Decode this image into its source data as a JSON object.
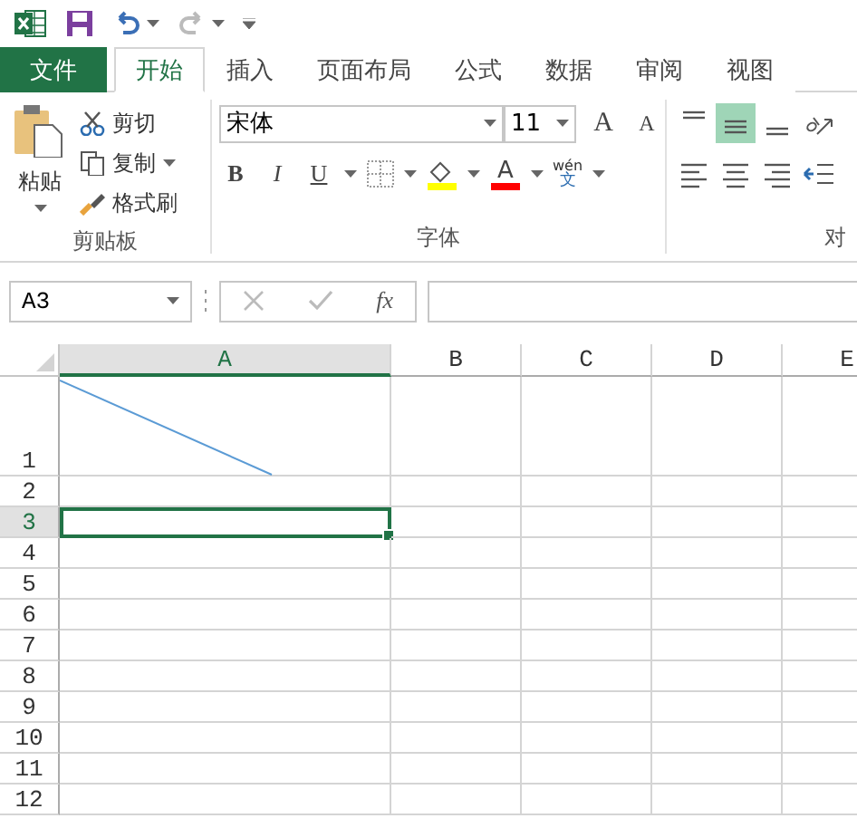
{
  "quick_access": [
    {
      "kind": "save",
      "disabled": false
    },
    {
      "kind": "undo",
      "disabled": false
    },
    {
      "kind": "redo",
      "disabled": true
    }
  ],
  "tabs": [
    {
      "label": "文件",
      "kind": "file",
      "selected": false
    },
    {
      "label": "开始",
      "kind": "tab",
      "selected": true
    },
    {
      "label": "插入",
      "kind": "tab",
      "selected": false
    },
    {
      "label": "页面布局",
      "kind": "tab",
      "selected": false
    },
    {
      "label": "公式",
      "kind": "tab",
      "selected": false
    },
    {
      "label": "数据",
      "kind": "tab",
      "selected": false
    },
    {
      "label": "审阅",
      "kind": "tab",
      "selected": false
    },
    {
      "label": "视图",
      "kind": "tab",
      "selected": false
    }
  ],
  "clipboard": {
    "paste": "粘贴",
    "cut": "剪切",
    "copy": "复制",
    "format_painter": "格式刷",
    "label": "剪贴板"
  },
  "font": {
    "name": "宋体",
    "size": "11",
    "grow": "A",
    "shrink": "A",
    "bold": "B",
    "italic": "I",
    "underline": "U",
    "font_color": "A",
    "phonetic_top": "wén",
    "phonetic_bottom": "文",
    "label": "字体"
  },
  "alignment": {
    "label": "对",
    "buttons": [
      {
        "kind": "top",
        "selected": false
      },
      {
        "kind": "middle",
        "selected": true
      },
      {
        "kind": "bottom",
        "selected": false
      },
      {
        "kind": "orient",
        "selected": false
      },
      {
        "kind": "left",
        "selected": false
      },
      {
        "kind": "center",
        "selected": false
      },
      {
        "kind": "right",
        "selected": false
      },
      {
        "kind": "outdent",
        "selected": false
      }
    ]
  },
  "formula_bar": {
    "name_box": "A3",
    "fx": "fx"
  },
  "sheet": {
    "columns": [
      {
        "label": "A",
        "selected": true
      },
      {
        "label": "B",
        "selected": false
      },
      {
        "label": "C",
        "selected": false
      },
      {
        "label": "D",
        "selected": false
      },
      {
        "label": "E",
        "selected": false
      }
    ],
    "rows": [
      {
        "label": "1",
        "selected": false
      },
      {
        "label": "2",
        "selected": false
      },
      {
        "label": "3",
        "selected": true
      },
      {
        "label": "4",
        "selected": false
      },
      {
        "label": "5",
        "selected": false
      },
      {
        "label": "6",
        "selected": false
      },
      {
        "label": "7",
        "selected": false
      },
      {
        "label": "8",
        "selected": false
      },
      {
        "label": "9",
        "selected": false
      },
      {
        "label": "10",
        "selected": false
      },
      {
        "label": "11",
        "selected": false
      },
      {
        "label": "12",
        "selected": false
      }
    ]
  }
}
